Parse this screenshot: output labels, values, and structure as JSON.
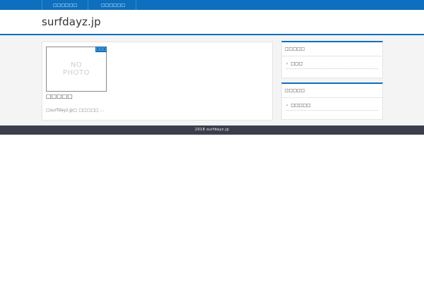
{
  "nav": {
    "items": [
      {
        "label": "□□□□□□"
      },
      {
        "label": "□□□□□□"
      }
    ]
  },
  "header": {
    "site_title": "surfdayz.jp"
  },
  "post": {
    "thumbnail_line1": "NO",
    "thumbnail_line2": "PHOTO",
    "category": "□□□",
    "title": "□□□□□",
    "excerpt": "□surfdayz.jp□ □□□□□ …"
  },
  "sidebar": {
    "widgets": [
      {
        "title": "□□□□□",
        "item": "□□□"
      },
      {
        "title": "□□□□□",
        "item": "□□□□□"
      }
    ]
  },
  "footer": {
    "copyright": "2018  surfdayz.jp"
  },
  "colors": {
    "accent": "#0d6fbd",
    "footer_bg": "#3a3f4b",
    "content_bg": "#f4f4f4"
  }
}
